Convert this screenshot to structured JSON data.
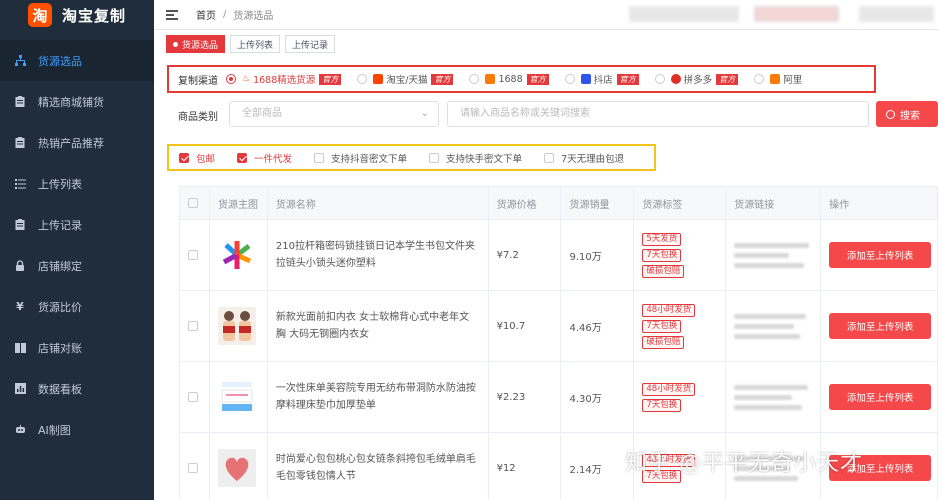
{
  "app": {
    "title": "淘宝复制",
    "logo_glyph": "淘"
  },
  "sidebar": {
    "items": [
      {
        "label": "货源选品",
        "icon": "sitemap-icon",
        "active": true
      },
      {
        "label": "精选商城铺货",
        "icon": "clipboard-icon"
      },
      {
        "label": "热销产品推荐",
        "icon": "clipboard-icon"
      },
      {
        "label": "上传列表",
        "icon": "list-icon"
      },
      {
        "label": "上传记录",
        "icon": "clipboard-icon"
      },
      {
        "label": "店铺绑定",
        "icon": "lock-icon"
      },
      {
        "label": "货源比价",
        "icon": "yen-icon"
      },
      {
        "label": "店铺对账",
        "icon": "book-icon"
      },
      {
        "label": "数据看板",
        "icon": "dashboard-icon"
      },
      {
        "label": "AI制图",
        "icon": "robot-icon"
      }
    ]
  },
  "breadcrumb": {
    "home": "首页",
    "sep": "/",
    "current": "货源选品"
  },
  "tags": [
    {
      "label": "货源选品",
      "active": true
    },
    {
      "label": "上传列表"
    },
    {
      "label": "上传记录"
    }
  ],
  "channels": {
    "label": "复制渠道",
    "official_label": "官方",
    "items": [
      {
        "label": "1688精选货源",
        "selected": true,
        "icon_color": "#ff5000"
      },
      {
        "label": "淘宝/天猫",
        "icon_color": "#ff4400"
      },
      {
        "label": "1688",
        "icon_color": "#ff7a00"
      },
      {
        "label": "抖店",
        "icon_color": "#2f54eb"
      },
      {
        "label": "拼多多",
        "icon_color": "#e02e24"
      },
      {
        "label": "阿里",
        "icon_color": "#ff7a00"
      }
    ]
  },
  "filters": {
    "category_label": "商品类别",
    "category_placeholder": "全部商品",
    "search_placeholder": "请输入商品名称或关键词搜索",
    "search_button": "搜索"
  },
  "options": [
    {
      "label": "包邮",
      "checked": true
    },
    {
      "label": "一件代发",
      "checked": true
    },
    {
      "label": "支持抖音密文下单",
      "checked": false
    },
    {
      "label": "支持快手密文下单",
      "checked": false
    },
    {
      "label": "7天无理由包退",
      "checked": false
    }
  ],
  "table": {
    "headers": [
      "货源主图",
      "货源名称",
      "货源价格",
      "货源销量",
      "货源标签",
      "货源链接",
      "操作"
    ],
    "action_label": "添加至上传列表",
    "rows": [
      {
        "name": "210拉杆箱密码锁挂锁日记本学生书包文件夹拉链头小锁头迷你塑料",
        "price": "¥7.2",
        "sales": "9.10万",
        "tags": [
          "5天发货",
          "7天包换",
          "破损包赔"
        ],
        "thumb": "lock-product"
      },
      {
        "name": "新款光面前扣内衣 女士软棉背心式中老年文胸 大码无钢圈内衣女",
        "price": "¥10.7",
        "sales": "4.46万",
        "tags": [
          "48小时发货",
          "7天包换",
          "破损包赔"
        ],
        "thumb": "underwear-product"
      },
      {
        "name": "一次性床单美容院专用无纺布带洞防水防油按摩料理床垫巾加厚垫单",
        "price": "¥2.23",
        "sales": "4.30万",
        "tags": [
          "48小时发货",
          "7天包换"
        ],
        "thumb": "sheet-product"
      },
      {
        "name": "时尚爱心包包桃心包女链条斜挎包毛绒单肩毛毛包零钱包情人节",
        "price": "¥12",
        "sales": "2.14万",
        "tags": [
          "48小时发货",
          "7天包换"
        ],
        "thumb": "heart-bag-product"
      }
    ]
  },
  "watermark": "知乎 @平平无奇小天才"
}
